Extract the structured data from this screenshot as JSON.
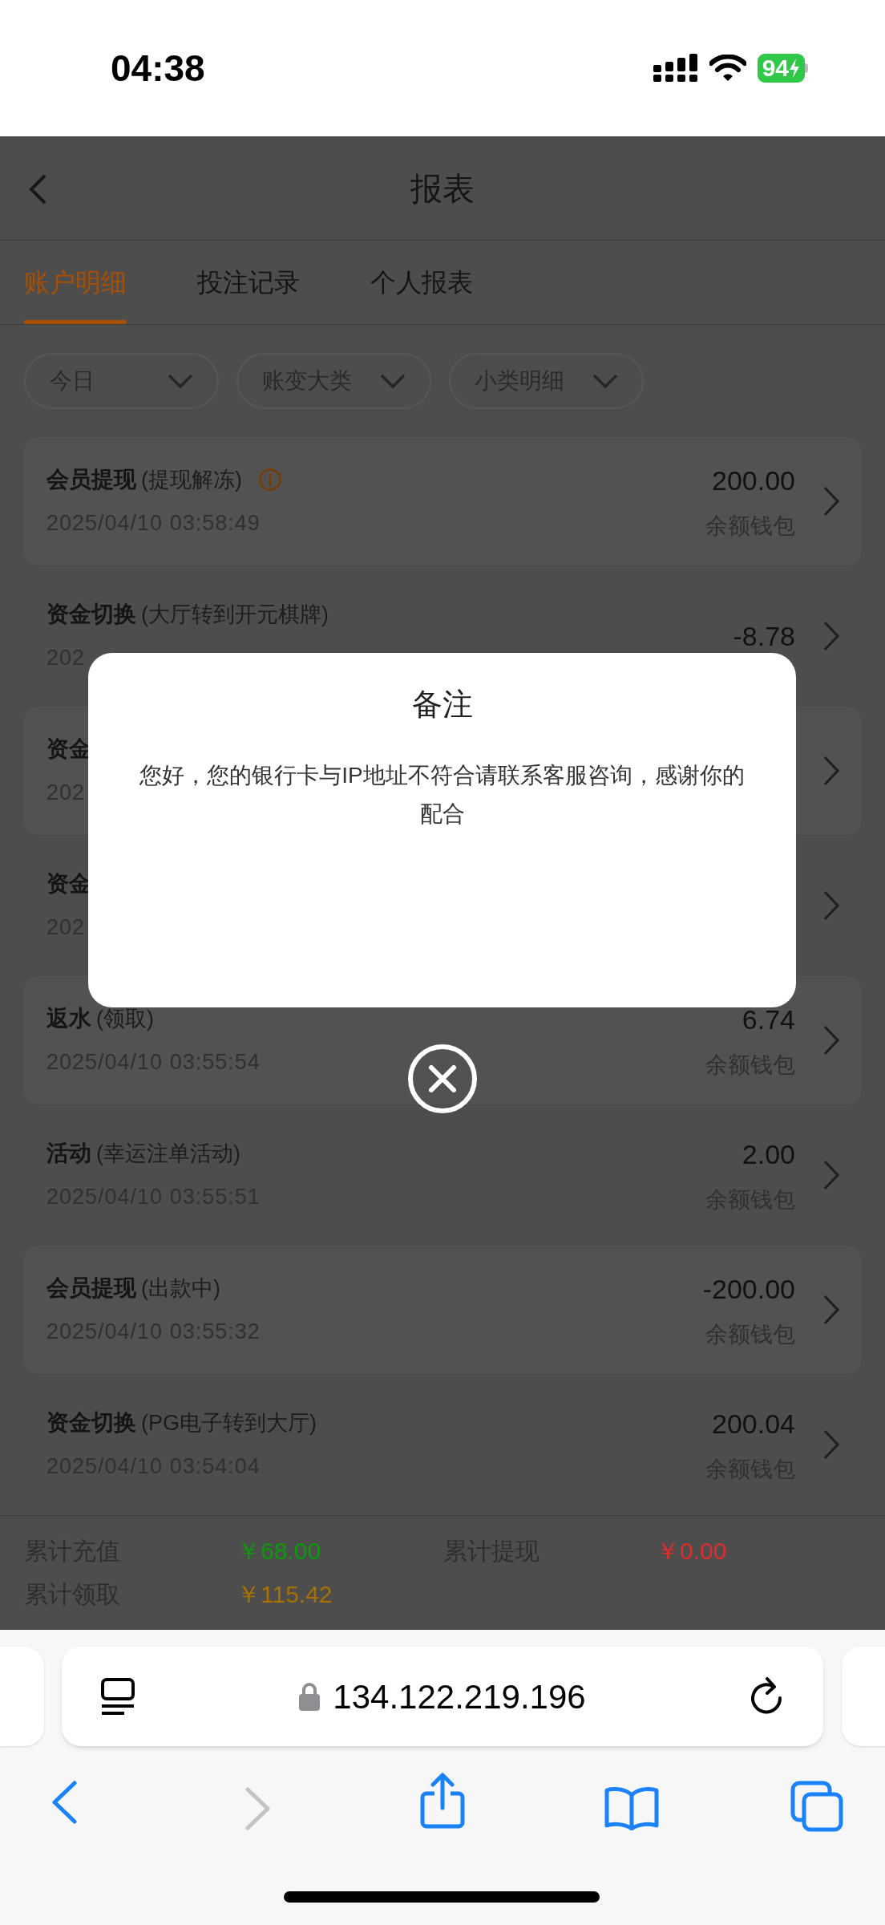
{
  "status_bar": {
    "time": "04:38",
    "battery": "94"
  },
  "nav": {
    "title": "报表"
  },
  "tabs": [
    {
      "label": "账户明细",
      "selected": true
    },
    {
      "label": "投注记录",
      "selected": false
    },
    {
      "label": "个人报表",
      "selected": false
    }
  ],
  "filters": [
    {
      "label": "今日"
    },
    {
      "label": "账变大类"
    },
    {
      "label": "小类明细"
    }
  ],
  "records": [
    {
      "title": "会员提现",
      "note": "(提现解冻)",
      "info": true,
      "date": "2025/04/10 03:58:49",
      "amount": "200.00",
      "wallet": "余额钱包"
    },
    {
      "title": "资金切换",
      "note": "(大厅转到开元棋牌)",
      "info": false,
      "date": "202",
      "amount": "-8.78"
    },
    {
      "title": "资金",
      "info": false,
      "date": "202"
    },
    {
      "title": "资金",
      "info": false,
      "date": "202"
    },
    {
      "title": "返水",
      "note": "(领取)",
      "info": false,
      "date": "2025/04/10 03:55:54",
      "amount": "6.74",
      "wallet": "余额钱包"
    },
    {
      "title": "活动",
      "note": "(幸运注单活动)",
      "info": false,
      "date": "2025/04/10 03:55:51",
      "amount": "2.00",
      "wallet": "余额钱包"
    },
    {
      "title": "会员提现",
      "note": "(出款中)",
      "info": false,
      "date": "2025/04/10 03:55:32",
      "amount": "-200.00",
      "wallet": "余额钱包"
    },
    {
      "title": "资金切换",
      "note": "(PG电子转到大厅)",
      "info": false,
      "date": "2025/04/10 03:54:04",
      "amount": "200.04",
      "wallet": "余额钱包"
    }
  ],
  "summary": [
    {
      "label": "累计充值",
      "value": "￥68.00",
      "color": "#0a9a0a"
    },
    {
      "label": "累计提现",
      "value": "￥0.00",
      "color": "#e02c2c"
    },
    {
      "label": "累计领取",
      "value": "￥115.42",
      "color": "#a87000"
    }
  ],
  "dialog": {
    "title": "备注",
    "message": "您好，您的银行卡与IP地址不符合请联系客服咨询，感谢你的配合"
  },
  "browser": {
    "url": "134.122.219.196"
  }
}
